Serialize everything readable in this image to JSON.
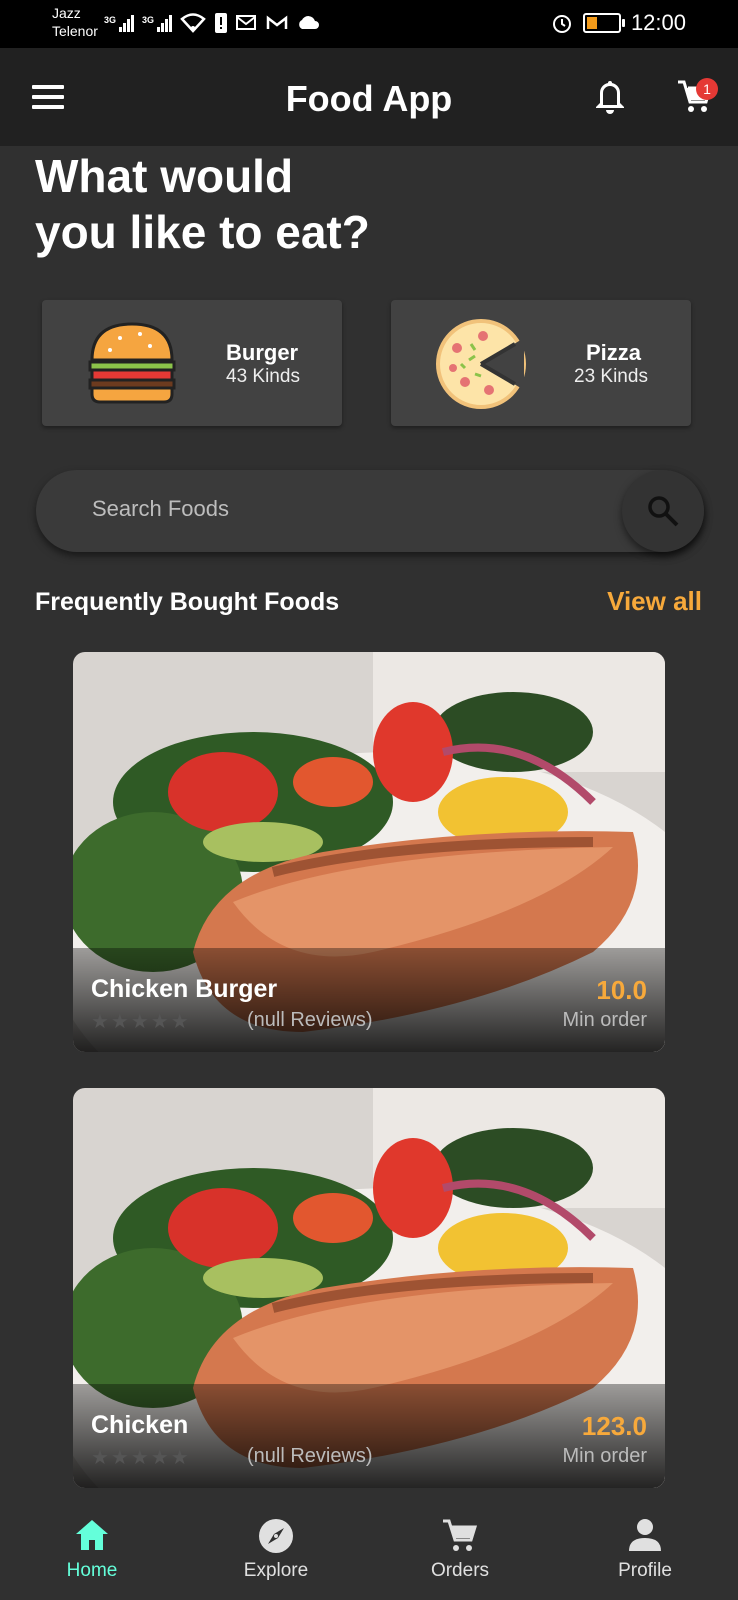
{
  "status_bar": {
    "carrier_1": "Jazz",
    "carrier_2": "Telenor",
    "network_1": "3G",
    "network_2": "3G",
    "time": "12:00"
  },
  "app_bar": {
    "title": "Food App",
    "cart_badge": "1"
  },
  "heading": {
    "line1": "What would",
    "line2": "you like to eat?"
  },
  "categories": [
    {
      "title": "Burger",
      "subtitle": "43 Kinds",
      "icon": "burger-icon"
    },
    {
      "title": "Pizza",
      "subtitle": "23 Kinds",
      "icon": "pizza-icon"
    }
  ],
  "search": {
    "placeholder": "Search Foods"
  },
  "section": {
    "title": "Frequently Bought Foods",
    "view_all": "View all"
  },
  "foods": [
    {
      "name": "Chicken Burger",
      "reviews": "(null Reviews)",
      "price": "10.0",
      "min_order": "Min order"
    },
    {
      "name": "Chicken",
      "reviews": "(null Reviews)",
      "price": "123.0",
      "min_order": "Min order"
    }
  ],
  "bottom_nav": {
    "items": [
      {
        "label": "Home",
        "icon": "home-icon",
        "active": true
      },
      {
        "label": "Explore",
        "icon": "compass-icon",
        "active": false
      },
      {
        "label": "Orders",
        "icon": "cart-icon",
        "active": false
      },
      {
        "label": "Profile",
        "icon": "person-icon",
        "active": false
      }
    ]
  },
  "colors": {
    "background": "#303030",
    "app_bar": "#212121",
    "accent_orange": "#f7a93b",
    "active_nav": "#64ffda",
    "badge_red": "#e53935"
  }
}
